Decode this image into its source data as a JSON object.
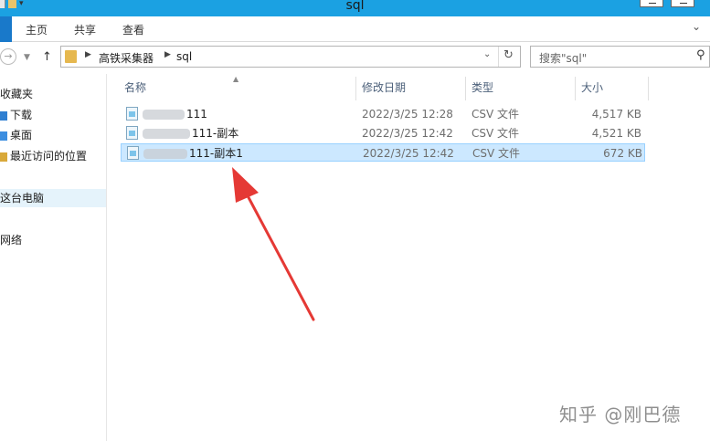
{
  "window": {
    "title": "sql"
  },
  "ribbon": {
    "tabs": [
      "主页",
      "共享",
      "查看"
    ]
  },
  "address": {
    "crumbs": [
      "高铁采集器",
      "sql"
    ]
  },
  "search": {
    "placeholder": "搜索\"sql\""
  },
  "nav": {
    "items": [
      {
        "label": "收藏夹",
        "icon": "star-icon"
      },
      {
        "label": "下载",
        "icon": "download-icon"
      },
      {
        "label": "桌面",
        "icon": "desktop-icon"
      },
      {
        "label": "最近访问的位置",
        "icon": "recent-icon"
      },
      {
        "label": "这台电脑",
        "icon": "computer-icon"
      },
      {
        "label": "网络",
        "icon": "network-icon"
      }
    ]
  },
  "columns": {
    "name": "名称",
    "modified": "修改日期",
    "type": "类型",
    "size": "大小"
  },
  "files": [
    {
      "name": "111",
      "modified": "2022/3/25 12:28",
      "type": "CSV 文件",
      "size": "4,517 KB",
      "selected": false
    },
    {
      "name": "111-副本",
      "modified": "2022/3/25 12:42",
      "type": "CSV 文件",
      "size": "4,521 KB",
      "selected": false
    },
    {
      "name": "111-副本1",
      "modified": "2022/3/25 12:42",
      "type": "CSV 文件",
      "size": "672 KB",
      "selected": true
    }
  ],
  "watermark": "知乎 @刚巴德",
  "colors": {
    "titlebar": "#1ba1e2",
    "selection": "#cce8ff",
    "arrow": "#e53935"
  }
}
